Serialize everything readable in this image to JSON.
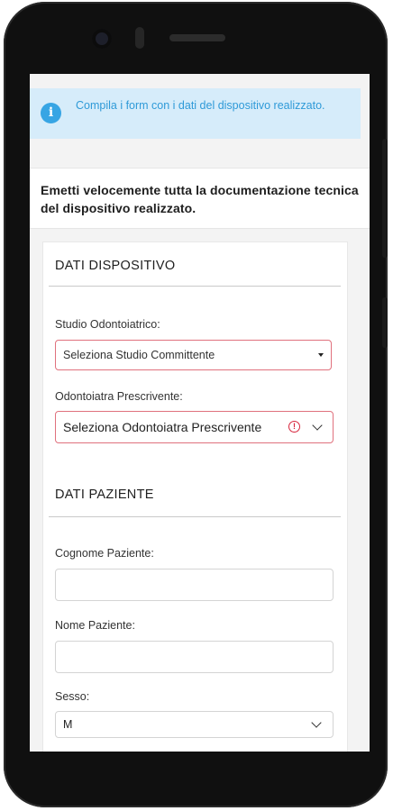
{
  "alert": {
    "icon": "info-icon",
    "text": "Compila i form con i dati del dispositivo realizzato."
  },
  "intro": {
    "text": "Emetti velocemente tutta la documentazione tecnica del dispositivo realizzato."
  },
  "dispositivo": {
    "title": "DATI DISPOSITIVO",
    "studio_label": "Studio Odontoiatrico:",
    "studio_value": "Seleziona Studio Committente",
    "odontoiatra_label": "Odontoiatra Prescrivente:",
    "odontoiatra_value": "Seleziona Odontoiatra Prescrivente"
  },
  "paziente": {
    "title": "DATI PAZIENTE",
    "cognome_label": "Cognome Paziente:",
    "cognome_value": "",
    "nome_label": "Nome Paziente:",
    "nome_value": "",
    "sesso_label": "Sesso:",
    "sesso_value": "M"
  },
  "colors": {
    "alert_bg": "#d6ecfa",
    "alert_text": "#2f9ad8",
    "error_border": "#e0717d",
    "error_icon": "#d7263d"
  }
}
